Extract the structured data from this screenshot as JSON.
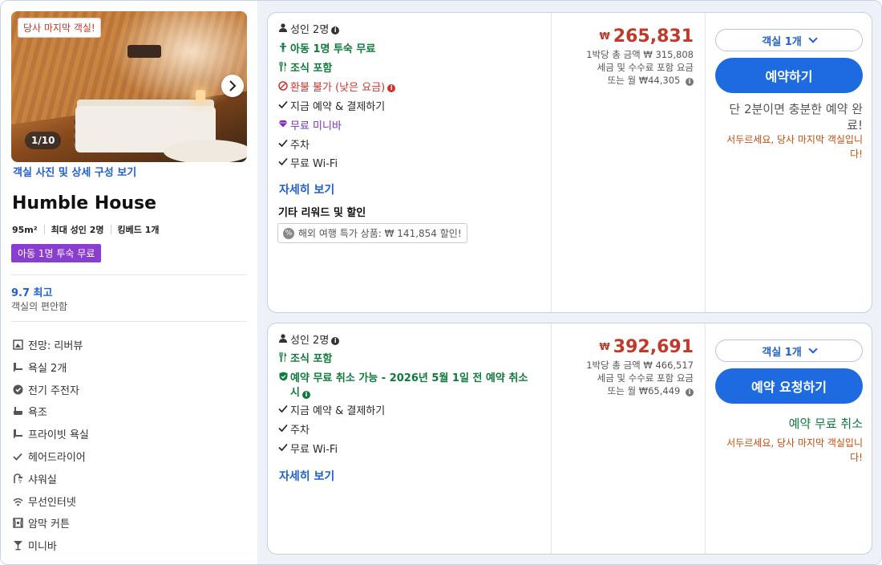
{
  "room": {
    "last_room_badge": "당사 마지막 객실!",
    "photo_counter": "1/10",
    "photo_link": "객실 사진 및 상세 구성 보기",
    "name": "Humble House",
    "size": "95m²",
    "max_guests": "최대 성인 2명",
    "bed": "킹베드 1개",
    "kid_badge": "아동 1명 투숙 무료",
    "score": "9.7 최고",
    "score_label": "객실의 편안함",
    "amenities": [
      {
        "icon": "view-icon",
        "label": "전망: 리버뷰"
      },
      {
        "icon": "bathroom-icon",
        "label": "욕실 2개"
      },
      {
        "icon": "bike-icon",
        "label": "전기 주전자"
      },
      {
        "icon": "bathtub-icon",
        "label": "욕조"
      },
      {
        "icon": "bathroom-icon",
        "label": "프라이빗 욕실"
      },
      {
        "icon": "check-icon",
        "label": "헤어드라이어"
      },
      {
        "icon": "shower-icon",
        "label": "샤워실"
      },
      {
        "icon": "wifi-icon",
        "label": "무선인터넷"
      },
      {
        "icon": "curtain-icon",
        "label": "암막 커튼"
      },
      {
        "icon": "minibar-icon",
        "label": "미니바"
      }
    ]
  },
  "offers": [
    {
      "guests": "성인 2명",
      "kid_free": "아동 1명 투숙 무료",
      "breakfast": "조식 포함",
      "refund": "환불 불가 (낮은 요금)",
      "pay_now": "지금 예약 & 결제하기",
      "minibar": "무료 미니바",
      "parking": "주차",
      "wifi": "무료 Wi-Fi",
      "more": "자세히 보기",
      "other_title": "기타 리워드 및 할인",
      "promo": "해외 여행 특가 상품: ₩ 141,854 할인!",
      "currency": "₩",
      "price": "265,831",
      "total": "1박당 총 금액 ₩ 315,808",
      "tax_note": "세금 및 수수료 포함 요금",
      "monthly": "또는 월 ₩44,305",
      "rooms_select": "객실 1개",
      "cta": "예약하기",
      "note_main": "단 2분이면 충분한 예약 완료!",
      "note_sub": "서두르세요, 당사 마지막 객실입니다!"
    },
    {
      "guests": "성인 2명",
      "breakfast": "조식 포함",
      "free_cancel": "예약 무료 취소 가능 - 2026년 5월 1일 전 예약 취소 시",
      "pay_now": "지금 예약 & 결제하기",
      "parking": "주차",
      "wifi": "무료 Wi-Fi",
      "more": "자세히 보기",
      "currency": "₩",
      "price": "392,691",
      "total": "1박당 총 금액 ₩ 466,517",
      "tax_note": "세금 및 수수료 포함 요금",
      "monthly": "또는 월 ₩65,449",
      "rooms_select": "객실 1개",
      "cta": "예약 요청하기",
      "note_main": "예약 무료 취소",
      "note_sub": "서두르세요, 당사 마지막 객실입니다!"
    }
  ],
  "colors": {
    "accent": "#1e6ae1",
    "price": "#c0392b",
    "green": "#0f7a3c",
    "purple_badge": "#8a3ecf"
  }
}
